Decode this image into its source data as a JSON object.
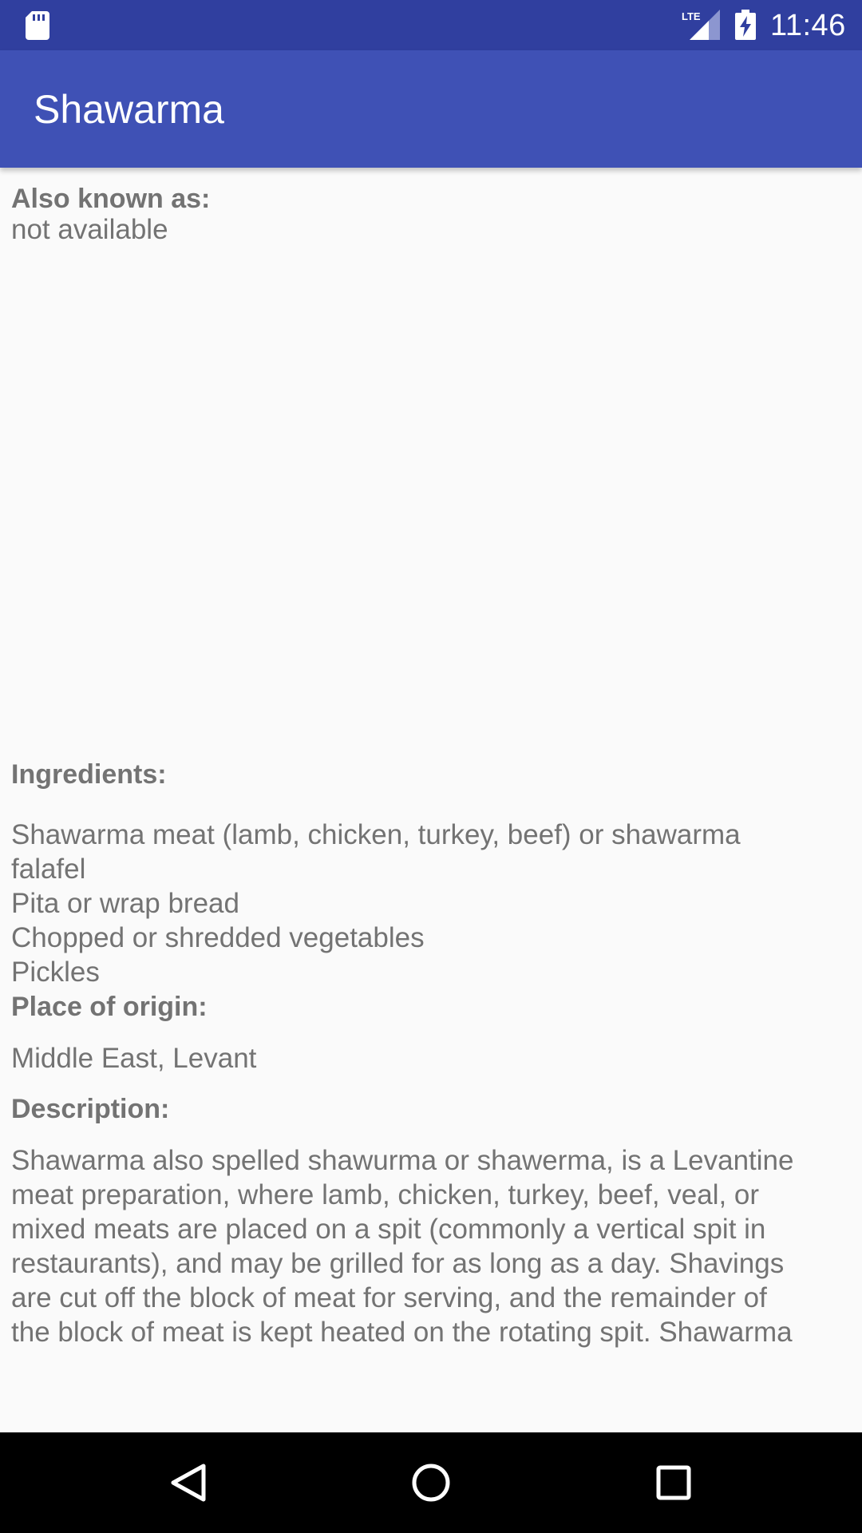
{
  "status_bar": {
    "time": "11:46",
    "icons": [
      "sd-card-icon",
      "lte-signal-icon",
      "battery-charging-icon"
    ],
    "network_label": "LTE"
  },
  "app_bar": {
    "title": "Shawarma",
    "color": "#3f51b5",
    "status_color": "#303f9f"
  },
  "sections": {
    "also_known_as": {
      "label": "Also known as:",
      "value": "not available"
    },
    "ingredients": {
      "label": "Ingredients:",
      "lines": [
        "Shawarma meat (lamb, chicken, turkey, beef) or shawarma",
        "falafel",
        "Pita or wrap bread",
        "Chopped or shredded vegetables",
        "Pickles"
      ]
    },
    "place_of_origin": {
      "label": "Place of origin:",
      "value": "Middle East, Levant"
    },
    "description": {
      "label": "Description:",
      "lines": [
        "Shawarma also spelled shawurma or shawerma, is a Levantine",
        "meat preparation, where lamb, chicken, turkey, beef, veal, or",
        "mixed meats are placed on a spit (commonly a vertical spit in",
        "restaurants), and may be grilled for as long as a day. Shavings",
        "are cut off the block of meat for serving, and the remainder of",
        "the block of meat is kept heated on the rotating spit. Shawarma"
      ]
    }
  },
  "nav_bar": {
    "buttons": [
      "back-icon",
      "home-icon",
      "recents-icon"
    ]
  }
}
